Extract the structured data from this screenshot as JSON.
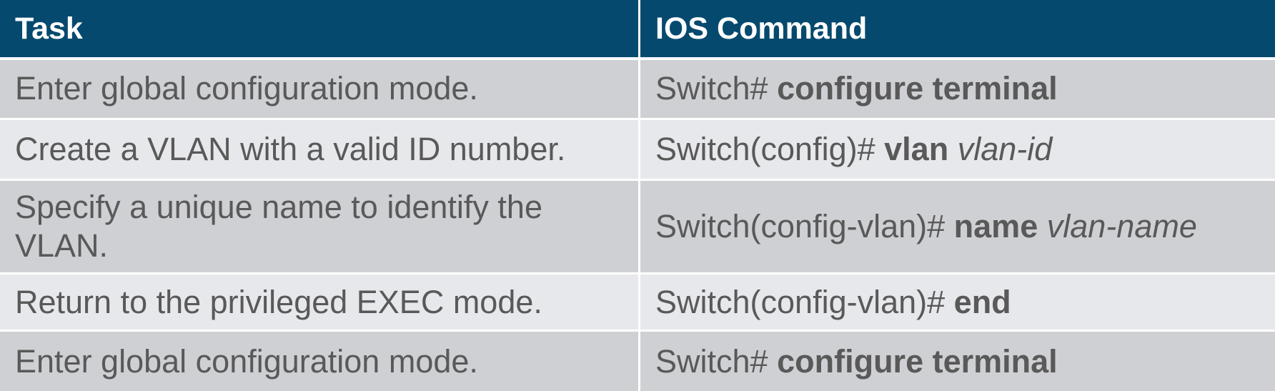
{
  "header": {
    "task": "Task",
    "command": "IOS Command"
  },
  "rows": [
    {
      "task": "Enter global configuration mode.",
      "prompt": "Switch#",
      "keyword": "configure terminal",
      "arg": ""
    },
    {
      "task": "Create a VLAN with a valid ID number.",
      "prompt": "Switch(config)#",
      "keyword": "vlan",
      "arg": "vlan-id"
    },
    {
      "task": "Specify a unique name to identify the VLAN.",
      "prompt": "Switch(config-vlan)#",
      "keyword": "name",
      "arg": "vlan-name"
    },
    {
      "task": "Return to the privileged EXEC mode.",
      "prompt": "Switch(config-vlan)#",
      "keyword": "end",
      "arg": ""
    },
    {
      "task": "Enter global configuration mode.",
      "prompt": "Switch#",
      "keyword": "configure terminal",
      "arg": ""
    }
  ],
  "colors": {
    "header_bg": "#054a6e",
    "row_dark": "#cfd0d4",
    "row_light": "#e7e8eb",
    "text": "#595959"
  }
}
